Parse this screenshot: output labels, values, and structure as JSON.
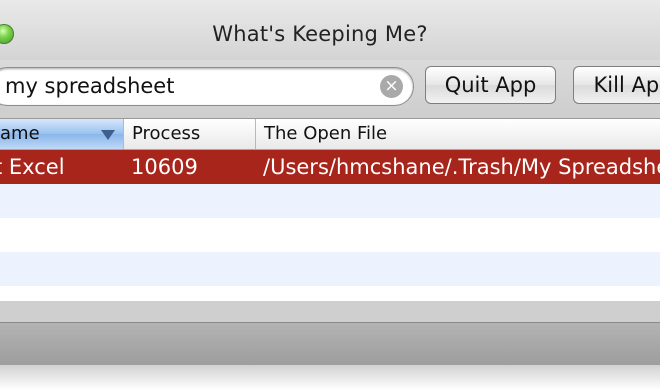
{
  "window": {
    "title": "What's Keeping Me?"
  },
  "toolbar": {
    "search_value": "my spreadsheet",
    "clear_icon": "clear-icon",
    "quit_label": "Quit App",
    "kill_label": "Kill App"
  },
  "table": {
    "columns": [
      "ame",
      "Process",
      "The Open File"
    ],
    "rows": [
      {
        "name": "t Excel",
        "process": "10609",
        "file": "/Users/hmcshane/.Trash/My Spreadsheet"
      }
    ],
    "selected_color": "#a8251c"
  }
}
